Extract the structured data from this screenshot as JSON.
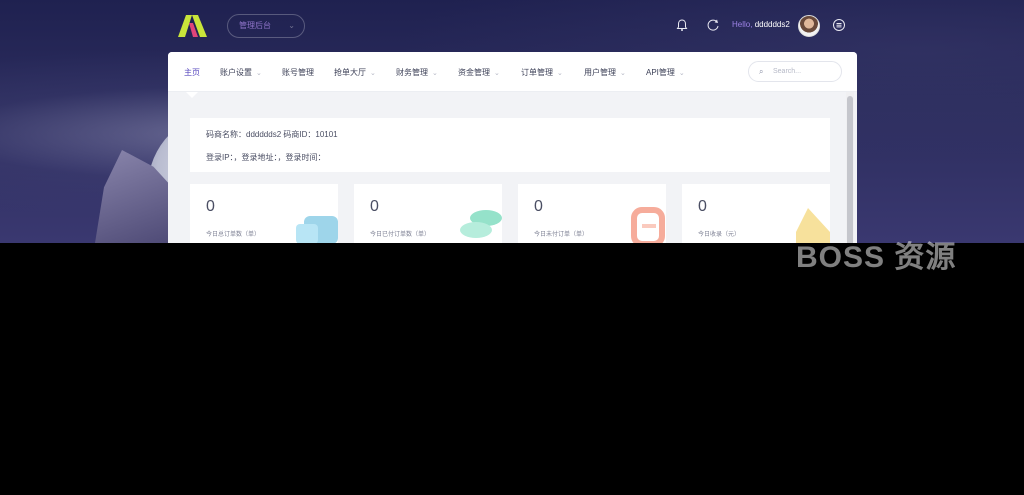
{
  "header": {
    "workspace_label": "管理后台",
    "hello_prefix": "Hello,",
    "username": "dddddds2"
  },
  "nav": {
    "items": [
      {
        "label": "主页",
        "dropdown": false,
        "active": true
      },
      {
        "label": "账户设置",
        "dropdown": true
      },
      {
        "label": "账号管理",
        "dropdown": false
      },
      {
        "label": "抢单大厅",
        "dropdown": true
      },
      {
        "label": "财务管理",
        "dropdown": true
      },
      {
        "label": "资金管理",
        "dropdown": true
      },
      {
        "label": "订单管理",
        "dropdown": true
      },
      {
        "label": "用户管理",
        "dropdown": true
      },
      {
        "label": "API管理",
        "dropdown": true
      }
    ],
    "search_placeholder": "Search..."
  },
  "info": {
    "line1": "码商名称：dddddds2  码商ID：10101",
    "line2": "登录IP：，登录地址：，登录时间："
  },
  "stats": [
    {
      "value": "0",
      "label": "今日总订单数（单）",
      "color": "#4fb3d9"
    },
    {
      "value": "0",
      "label": "今日已付订单数（单）",
      "color": "#3fcca0"
    },
    {
      "value": "0",
      "label": "今日未付订单（单）",
      "color": "#f06a4a"
    },
    {
      "value": "0",
      "label": "今日收录（元）",
      "color": "#f2c94c"
    }
  ],
  "watermark": "BOSS 资源",
  "colors": {
    "accent": "#5a4bbf",
    "logo_left": "#c9e53a",
    "logo_right": "#e0457a"
  }
}
